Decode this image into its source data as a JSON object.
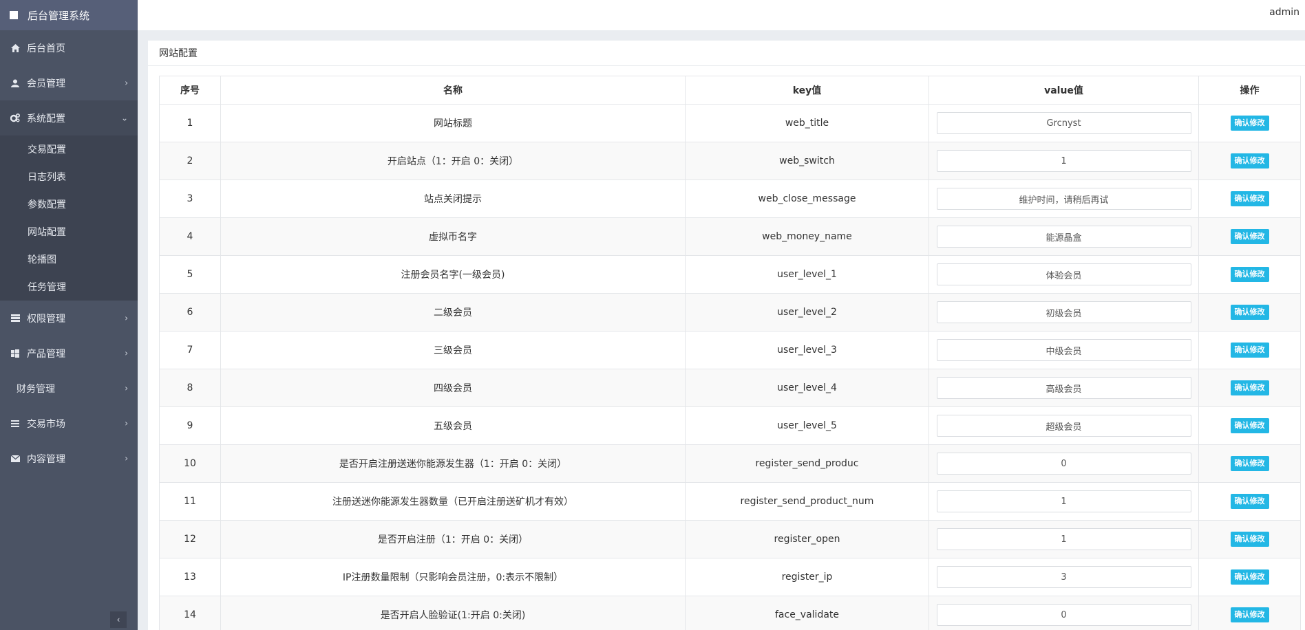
{
  "app": {
    "title": "后台管理系统",
    "user": "admin"
  },
  "sidebar": {
    "items": [
      {
        "label": "后台首页",
        "icon": "home-icon",
        "chevron": ""
      },
      {
        "label": "会员管理",
        "icon": "user-icon",
        "chevron": "›"
      },
      {
        "label": "系统配置",
        "icon": "cogs-icon",
        "chevron": "⌄"
      }
    ],
    "submenu": [
      "交易配置",
      "日志列表",
      "参数配置",
      "网站配置",
      "轮播图",
      "任务管理"
    ],
    "items2": [
      {
        "label": "权限管理",
        "icon": "permission-icon",
        "chevron": "›"
      },
      {
        "label": "产品管理",
        "icon": "windows-icon",
        "chevron": "›"
      },
      {
        "label": "财务管理",
        "icon": "",
        "chevron": "›"
      },
      {
        "label": "交易市场",
        "icon": "list-icon",
        "chevron": "›"
      },
      {
        "label": "内容管理",
        "icon": "envelope-icon",
        "chevron": "›"
      }
    ],
    "collapse": "‹"
  },
  "panel": {
    "title": "网站配置"
  },
  "table": {
    "headers": [
      "序号",
      "名称",
      "key值",
      "value值",
      "操作"
    ],
    "button_label": "确认修改",
    "rows": [
      {
        "id": "1",
        "name": "网站标题",
        "key": "web_title",
        "value": "Grcnyst"
      },
      {
        "id": "2",
        "name": "开启站点（1：开启 0：关闭）",
        "key": "web_switch",
        "value": "1"
      },
      {
        "id": "3",
        "name": "站点关闭提示",
        "key": "web_close_message",
        "value": "维护时间，请稍后再试"
      },
      {
        "id": "4",
        "name": "虚拟币名字",
        "key": "web_money_name",
        "value": "能源晶盒"
      },
      {
        "id": "5",
        "name": "注册会员名字(一级会员)",
        "key": "user_level_1",
        "value": "体验会员"
      },
      {
        "id": "6",
        "name": "二级会员",
        "key": "user_level_2",
        "value": "初级会员"
      },
      {
        "id": "7",
        "name": "三级会员",
        "key": "user_level_3",
        "value": "中级会员"
      },
      {
        "id": "8",
        "name": "四级会员",
        "key": "user_level_4",
        "value": "高级会员"
      },
      {
        "id": "9",
        "name": "五级会员",
        "key": "user_level_5",
        "value": "超级会员"
      },
      {
        "id": "10",
        "name": "是否开启注册送迷你能源发生器（1：开启 0：关闭）",
        "key": "register_send_produc",
        "value": "0"
      },
      {
        "id": "11",
        "name": "注册送迷你能源发生器数量（已开启注册送矿机才有效）",
        "key": "register_send_product_num",
        "value": "1"
      },
      {
        "id": "12",
        "name": "是否开启注册（1：开启 0：关闭）",
        "key": "register_open",
        "value": "1"
      },
      {
        "id": "13",
        "name": "IP注册数量限制（只影响会员注册，0:表示不限制）",
        "key": "register_ip",
        "value": "3"
      },
      {
        "id": "14",
        "name": "是否开启人脸验证(1:开启 0:关闭)",
        "key": "face_validate",
        "value": "0"
      }
    ]
  }
}
